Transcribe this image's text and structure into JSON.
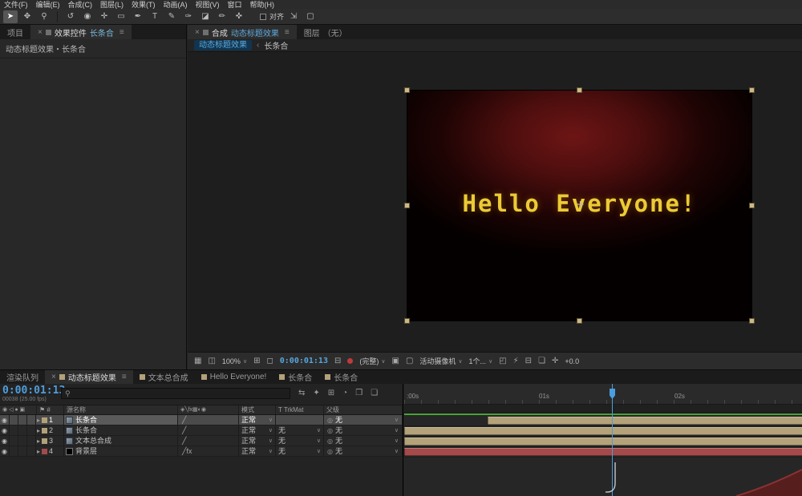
{
  "ui": {
    "close": "×",
    "menu_glyph": "≡",
    "caret": "∨",
    "twirl": "▸",
    "pickwhip": "◎",
    "eye": "◉",
    "search_glyph": "⚲",
    "breadcrumb_sep": "‹",
    "anchor_glyph": "✛",
    "colors": {
      "accent_blue": "#4a9ede",
      "timecode_blue": "#4e9edc",
      "label_tan": "#b3a179",
      "label_red": "#a34a4a",
      "title_yellow": "#ecca35",
      "work_area_green": "#47a437"
    }
  },
  "menu": {
    "items": [
      "文件(F)",
      "编辑(E)",
      "合成(C)",
      "图层(L)",
      "效果(T)",
      "动画(A)",
      "视图(V)",
      "窗口",
      "帮助(H)"
    ]
  },
  "toolbar": {
    "tools": [
      {
        "name": "selection-tool",
        "glyph": "➤"
      },
      {
        "name": "hand-tool",
        "glyph": "✥"
      },
      {
        "name": "zoom-tool",
        "glyph": "⚲"
      },
      {
        "name": "rotation-tool",
        "glyph": "↺"
      },
      {
        "name": "camera-tool",
        "glyph": "◉"
      },
      {
        "name": "pan-behind-tool",
        "glyph": "✛"
      },
      {
        "name": "shape-tool",
        "glyph": "▭"
      },
      {
        "name": "pen-tool",
        "glyph": "✒"
      },
      {
        "name": "type-tool",
        "glyph": "T"
      },
      {
        "name": "brush-tool",
        "glyph": "✎"
      },
      {
        "name": "clone-stamp-tool",
        "glyph": "✑"
      },
      {
        "name": "eraser-tool",
        "glyph": "◪"
      },
      {
        "name": "roto-brush-tool",
        "glyph": "✏"
      },
      {
        "name": "puppet-pin-tool",
        "glyph": "✜"
      }
    ],
    "align_label": "对齐",
    "workspace_icons": [
      {
        "name": "shrink-boundaries-icon",
        "glyph": "⇲"
      },
      {
        "name": "snapping-icon",
        "glyph": "▢"
      }
    ]
  },
  "left_panel": {
    "tab_project": "项目",
    "tab_effects": "效果控件",
    "tab_effects_target": "长条合",
    "content_line": "动态标题效果・长条合"
  },
  "comp_panel": {
    "tab_comp_prefix": "合成",
    "tab_comp_name": "动态标题效果",
    "tab_layer_prefix": "图层",
    "tab_layer_suffix": "（无）",
    "breadcrumb_comp": "动态标题效果",
    "breadcrumb_layer": "长条合",
    "canvas_text": "Hello Everyone!",
    "viewer": {
      "icons_pre": [
        {
          "name": "always-preview-icon",
          "glyph": "▦"
        },
        {
          "name": "primary-viewer-icon",
          "glyph": "◫"
        }
      ],
      "zoom": "100%",
      "icons_mid": [
        {
          "name": "grid-guides-icon",
          "glyph": "⊞"
        },
        {
          "name": "mask-visibility-icon",
          "glyph": "◻"
        }
      ],
      "timecode": "0:00:01:13",
      "snapshot_glyph": "⊟",
      "resolution": "(完整)",
      "icons_roi": [
        {
          "name": "region-of-interest-icon",
          "glyph": "▣"
        },
        {
          "name": "transparency-grid-icon",
          "glyph": "▢"
        }
      ],
      "camera": "活动摄像机",
      "view_layout": "1个...",
      "icons_post": [
        {
          "name": "pixel-aspect-icon",
          "glyph": "◰"
        },
        {
          "name": "fast-previews-icon",
          "glyph": "⚡"
        },
        {
          "name": "timeline-button-icon",
          "glyph": "⊟"
        },
        {
          "name": "comp-flowchart-icon",
          "glyph": "❏"
        },
        {
          "name": "reset-exposure-icon",
          "glyph": "✛"
        }
      ],
      "exposure": "+0.0"
    }
  },
  "timeline": {
    "tabs": [
      {
        "label": "渲染队列"
      },
      {
        "label": "动态标题效果"
      },
      {
        "label": "文本总合成"
      },
      {
        "label": "Hello Everyone!"
      },
      {
        "label": "长条合"
      },
      {
        "label": "长条合"
      }
    ],
    "timecode": "0:00:01:13",
    "frame_info": "00038 (25.00 fps)",
    "columns": {
      "av_icons": "◉ ◁ ● ▣",
      "label_hash": "⚑ #",
      "name": "源名称",
      "switches": "◈╲fx▦◐◉",
      "mode": "模式",
      "trkmat": "T TrkMat",
      "parent": "父级"
    },
    "search_icons": [
      {
        "name": "mini-flowchart-icon",
        "glyph": "⇆"
      },
      {
        "name": "draft-3d-icon",
        "glyph": "✦"
      },
      {
        "name": "hide-shy-icon",
        "glyph": "⊞"
      },
      {
        "name": "frame-blend-icon",
        "glyph": "◔"
      },
      {
        "name": "motion-blur-icon",
        "glyph": "❒"
      },
      {
        "name": "graph-editor-icon",
        "glyph": "❏"
      }
    ],
    "layers": [
      {
        "num": "1",
        "name": "长条合",
        "switches": "╱",
        "mode": "正常",
        "trkmat": "",
        "parent": "无"
      },
      {
        "num": "2",
        "name": "长条合",
        "switches": "╱",
        "mode": "正常",
        "trkmat": "无",
        "parent": "无"
      },
      {
        "num": "3",
        "name": "文本总合成",
        "switches": "╱",
        "mode": "正常",
        "trkmat": "无",
        "parent": "无"
      },
      {
        "num": "4",
        "name": "背景层",
        "switches": "╱fx",
        "mode": "正常",
        "trkmat": "无",
        "parent": "无"
      }
    ],
    "ruler_labels": [
      ":00s",
      "01s",
      "02s"
    ]
  }
}
